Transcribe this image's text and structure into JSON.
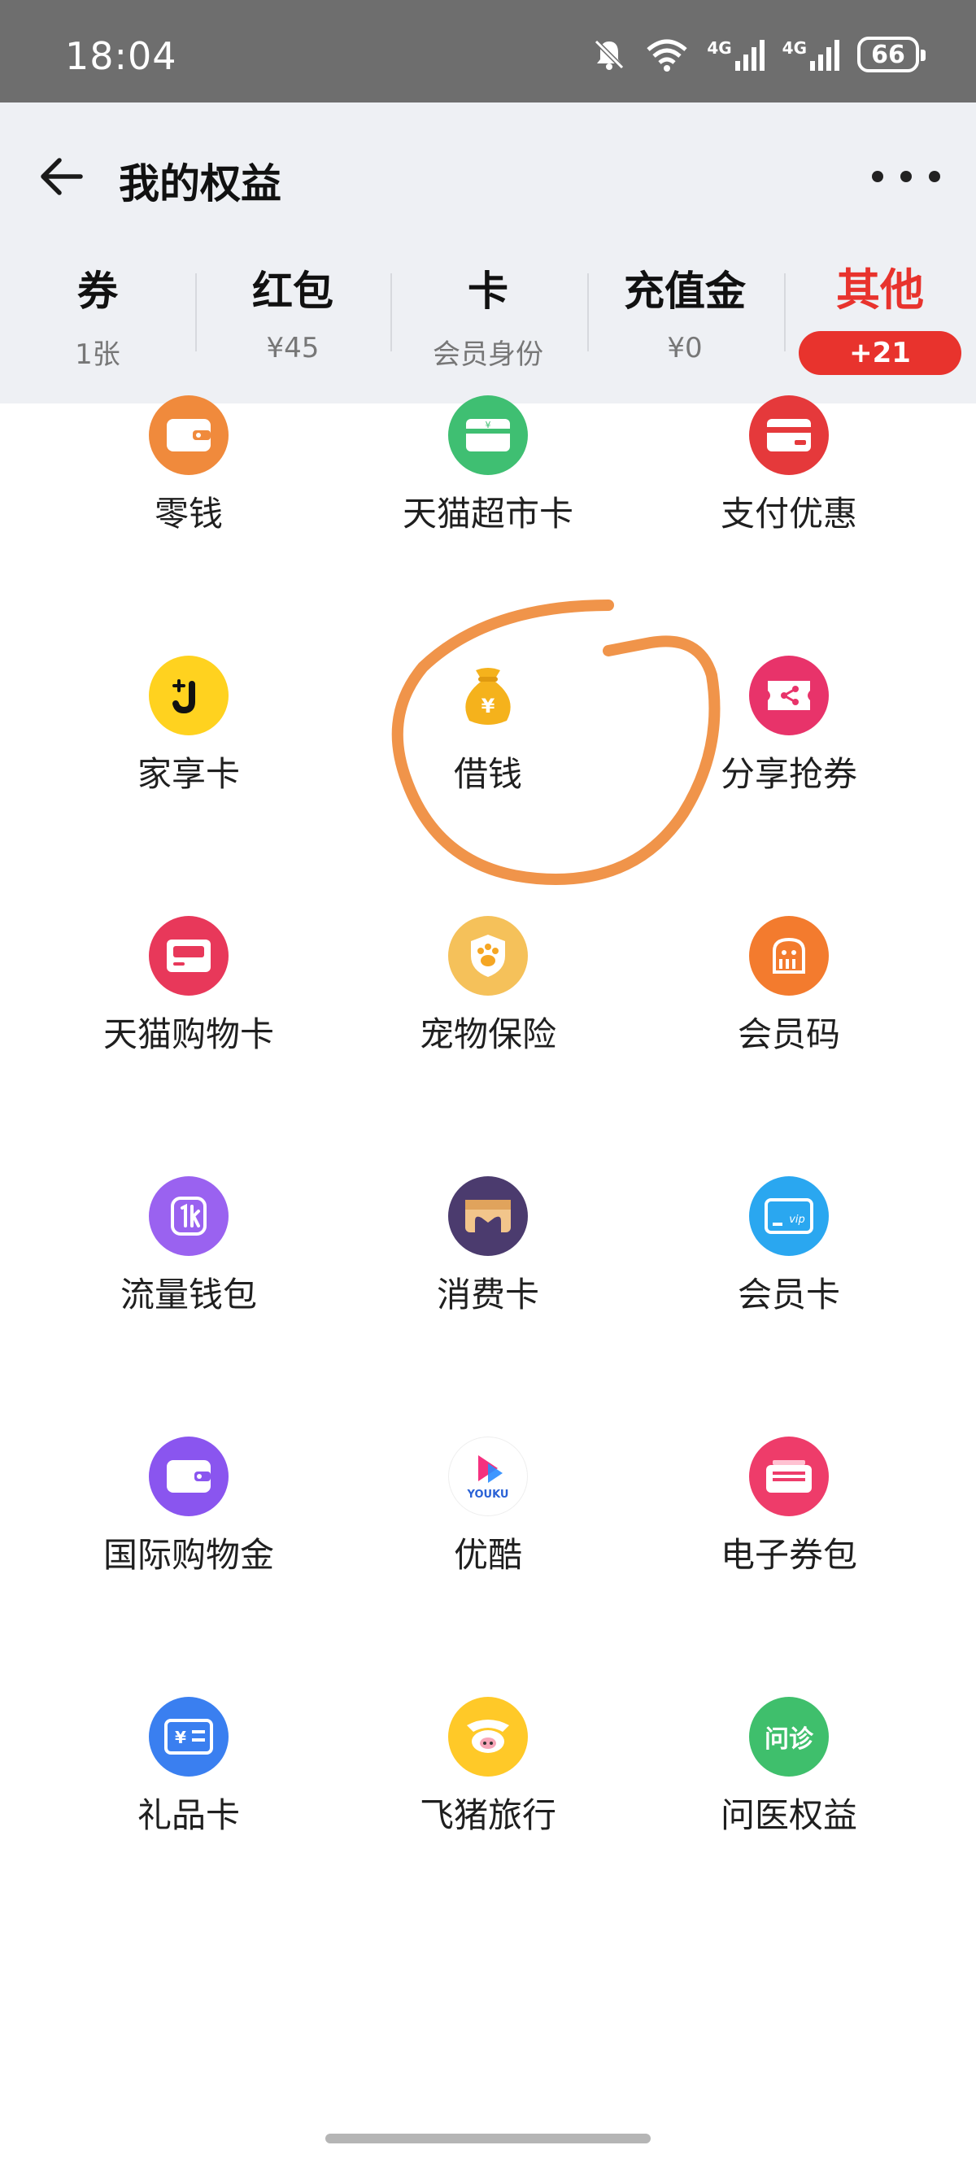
{
  "status_bar": {
    "time": "18:04",
    "network_1": "4G",
    "network_2": "4G",
    "battery": "66"
  },
  "header": {
    "title": "我的权益"
  },
  "tabs": [
    {
      "label": "券",
      "sub": "1张"
    },
    {
      "label": "红包",
      "sub": "¥45"
    },
    {
      "label": "卡",
      "sub": "会员身份"
    },
    {
      "label": "充值金",
      "sub": "¥0"
    },
    {
      "label": "其他",
      "badge": "+21",
      "active": true
    }
  ],
  "grid": [
    {
      "label": "零钱",
      "icon": "wallet-icon",
      "color": "#f08a3c"
    },
    {
      "label": "天猫超市卡",
      "icon": "supermarket-card-icon",
      "color": "#3fbf72"
    },
    {
      "label": "支付优惠",
      "icon": "payment-card-icon",
      "color": "#e5393b"
    },
    {
      "label": "家享卡",
      "icon": "family-card-icon",
      "color": "#ffd21f"
    },
    {
      "label": "借钱",
      "icon": "money-bag-icon",
      "color": "#f5b21c"
    },
    {
      "label": "分享抢券",
      "icon": "share-coupon-icon",
      "color": "#e8336a"
    },
    {
      "label": "天猫购物卡",
      "icon": "shopping-card-icon",
      "color": "#e8385a"
    },
    {
      "label": "宠物保险",
      "icon": "pet-insurance-icon",
      "color": "#f5c15a"
    },
    {
      "label": "会员码",
      "icon": "member-code-icon",
      "color": "#f37b2e"
    },
    {
      "label": "流量钱包",
      "icon": "data-wallet-icon",
      "color": "#9a62f0"
    },
    {
      "label": "消费卡",
      "icon": "consumer-card-icon",
      "color": "#4b3b6e"
    },
    {
      "label": "会员卡",
      "icon": "vip-card-icon",
      "color": "#2aa7f0"
    },
    {
      "label": "国际购物金",
      "icon": "global-wallet-icon",
      "color": "#8a55ef"
    },
    {
      "label": "优酷",
      "icon": "youku-icon",
      "color": "#ffffff",
      "logo_text": "YOUKU"
    },
    {
      "label": "电子券包",
      "icon": "e-coupon-icon",
      "color": "#ee3c6a"
    },
    {
      "label": "礼品卡",
      "icon": "gift-card-icon",
      "color": "#3a7ff0"
    },
    {
      "label": "飞猪旅行",
      "icon": "fliggy-icon",
      "color": "#ffc928"
    },
    {
      "label": "问医权益",
      "icon": "doctor-consult-icon",
      "color": "#3fbf6c",
      "icon_text": "问诊"
    }
  ]
}
